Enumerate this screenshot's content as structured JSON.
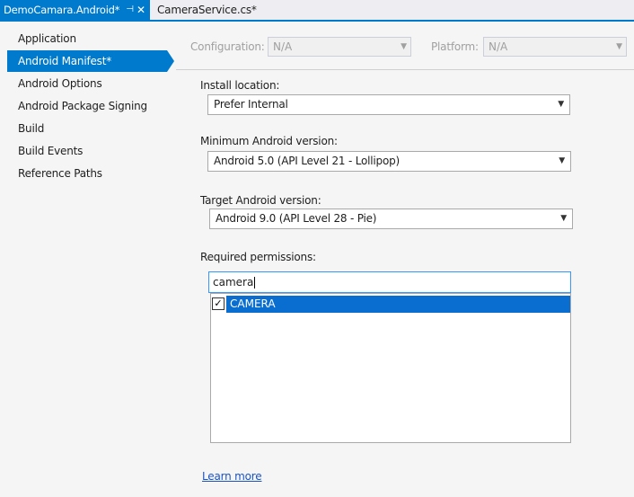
{
  "tabs": {
    "active_label": "DemoCamara.Android*",
    "pin_glyph": "⊣",
    "close_glyph": "✕",
    "inactive_label": "CameraService.cs*"
  },
  "sidebar": {
    "items": [
      {
        "label": "Application",
        "selected": false
      },
      {
        "label": "Android Manifest*",
        "selected": true
      },
      {
        "label": "Android Options",
        "selected": false
      },
      {
        "label": "Android Package Signing",
        "selected": false
      },
      {
        "label": "Build",
        "selected": false
      },
      {
        "label": "Build Events",
        "selected": false
      },
      {
        "label": "Reference Paths",
        "selected": false
      }
    ]
  },
  "config_bar": {
    "configuration_label": "Configuration:",
    "configuration_value": "N/A",
    "platform_label": "Platform:",
    "platform_value": "N/A"
  },
  "form": {
    "install_location_label": "Install location:",
    "install_location_value": "Prefer Internal",
    "min_android_label": "Minimum Android version:",
    "min_android_value": "Android 5.0 (API Level 21 - Lollipop)",
    "target_android_label": "Target Android version:",
    "target_android_value": "Android 9.0 (API Level 28 - Pie)",
    "permissions_label": "Required permissions:",
    "permissions_search_value": "camera",
    "permissions": [
      {
        "label": "CAMERA",
        "checked": true
      }
    ],
    "learn_more": "Learn more"
  },
  "colors": {
    "accent": "#007acc",
    "selection": "#0a6ed1",
    "link": "#1a54c4"
  }
}
